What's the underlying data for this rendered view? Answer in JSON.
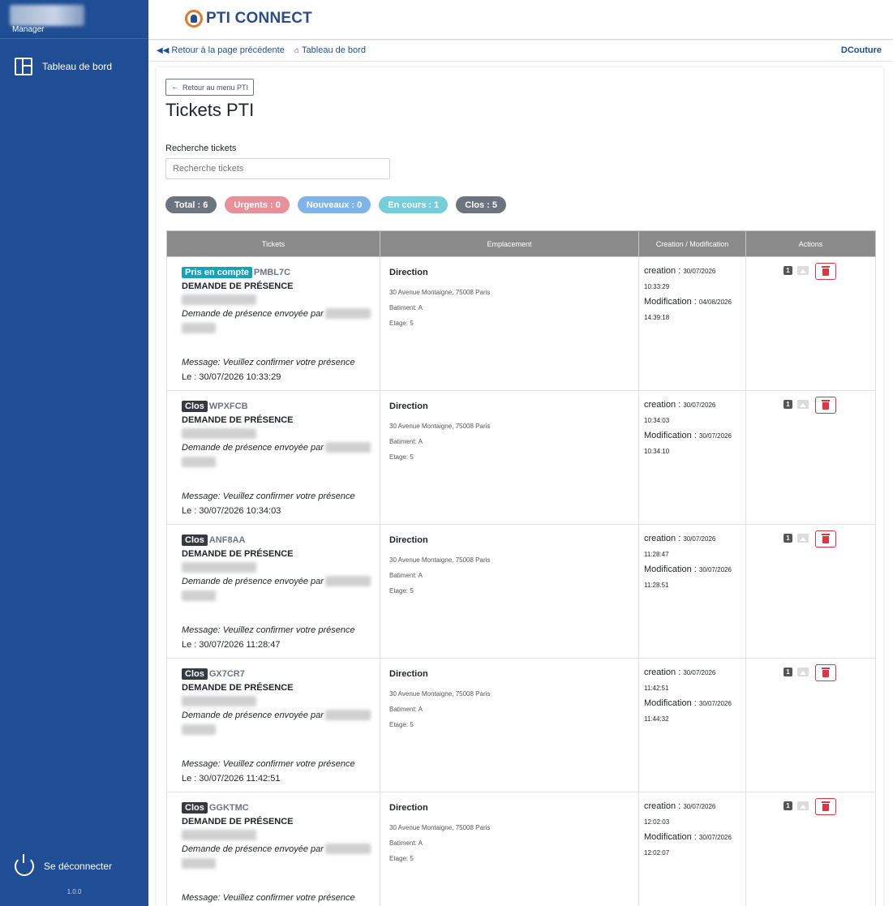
{
  "sidebar": {
    "role": "Manager",
    "nav_item": "Tableau de bord",
    "logout": "Se déconnecter",
    "version": "1.0.0"
  },
  "header": {
    "logo_text": "PTI CONNECT"
  },
  "breadcrumb": {
    "back": "Retour à la page précédente",
    "dashboard": "Tableau de bord",
    "user": "DCouture"
  },
  "page": {
    "back_button": "Retour au menu PTI",
    "title": "Tickets PTI",
    "search_label": "Recherche tickets",
    "search_placeholder": "Recherche tickets"
  },
  "filters": [
    {
      "label": "Total : 6",
      "color": "#6c757d"
    },
    {
      "label": "Urgents : 0",
      "color": "#e8909a"
    },
    {
      "label": "Nouveaux : 0",
      "color": "#7fb4ea"
    },
    {
      "label": "En cours : 1",
      "color": "#74cfd9"
    },
    {
      "label": "Clos : 5",
      "color": "#6c757d"
    }
  ],
  "table": {
    "headers": [
      "Tickets",
      "Emplacement",
      "Creation / Modification",
      "Actions"
    ],
    "rows": [
      {
        "status": "Pris en compte",
        "status_color": "#17a2b8",
        "code": "PMBL7C",
        "title": "DEMANDE DE PRÉSENCE",
        "sent": "Demande de présence envoyée par",
        "message": "Message: Veuillez confirmer votre présence",
        "date": "Le : 30/07/2026 10:33:29",
        "location": "Direction",
        "address": "30 Avenue Montaigne, 75008 Paris",
        "building": "Batiment: A",
        "floor": "Etage: 5",
        "creation_label": "creation :",
        "creation_date": "30/07/2026",
        "creation_time": "10:33:29",
        "modification_label": "Modification :",
        "modification_date": "04/08/2026",
        "modification_time": "14:39:18",
        "count": "1"
      },
      {
        "status": "Clos",
        "status_color": "#343a40",
        "code": "WPXFCB",
        "title": "DEMANDE DE PRÉSENCE",
        "sent": "Demande de présence envoyée par",
        "message": "Message: Veuillez confirmer votre présence",
        "date": "Le : 30/07/2026 10:34:03",
        "location": "Direction",
        "address": "30 Avenue Montaigne, 75008 Paris",
        "building": "Batiment: A",
        "floor": "Etage: 5",
        "creation_label": "creation :",
        "creation_date": "30/07/2026",
        "creation_time": "10:34:03",
        "modification_label": "Modification :",
        "modification_date": "30/07/2026",
        "modification_time": "10:34:10",
        "count": "1"
      },
      {
        "status": "Clos",
        "status_color": "#343a40",
        "code": "ANF8AA",
        "title": "DEMANDE DE PRÉSENCE",
        "sent": "Demande de présence envoyée par",
        "message": "Message: Veuillez confirmer votre présence",
        "date": "Le : 30/07/2026 11:28:47",
        "location": "Direction",
        "address": "30 Avenue Montaigne, 75008 Paris",
        "building": "Batiment: A",
        "floor": "Etage: 5",
        "creation_label": "creation :",
        "creation_date": "30/07/2026",
        "creation_time": "11:28:47",
        "modification_label": "Modification :",
        "modification_date": "30/07/2026",
        "modification_time": "11:28:51",
        "count": "1"
      },
      {
        "status": "Clos",
        "status_color": "#343a40",
        "code": "GX7CR7",
        "title": "DEMANDE DE PRÉSENCE",
        "sent": "Demande de présence envoyée par",
        "message": "Message: Veuillez confirmer votre présence",
        "date": "Le : 30/07/2026 11:42:51",
        "location": "Direction",
        "address": "30 Avenue Montaigne, 75008 Paris",
        "building": "Batiment: A",
        "floor": "Etage: 5",
        "creation_label": "creation :",
        "creation_date": "30/07/2026",
        "creation_time": "11:42:51",
        "modification_label": "Modification :",
        "modification_date": "30/07/2026",
        "modification_time": "11:44:32",
        "count": "1"
      },
      {
        "status": "Clos",
        "status_color": "#343a40",
        "code": "GGKTMC",
        "title": "DEMANDE DE PRÉSENCE",
        "sent": "Demande de présence envoyée par",
        "message": "Message: Veuillez confirmer votre présence",
        "date": "",
        "location": "Direction",
        "address": "30 Avenue Montaigne, 75008 Paris",
        "building": "Batiment: A",
        "floor": "Etage: 5",
        "creation_label": "creation :",
        "creation_date": "30/07/2026",
        "creation_time": "12:02:03",
        "modification_label": "Modification :",
        "modification_date": "30/07/2026",
        "modification_time": "12:02:07",
        "count": "1"
      }
    ]
  }
}
